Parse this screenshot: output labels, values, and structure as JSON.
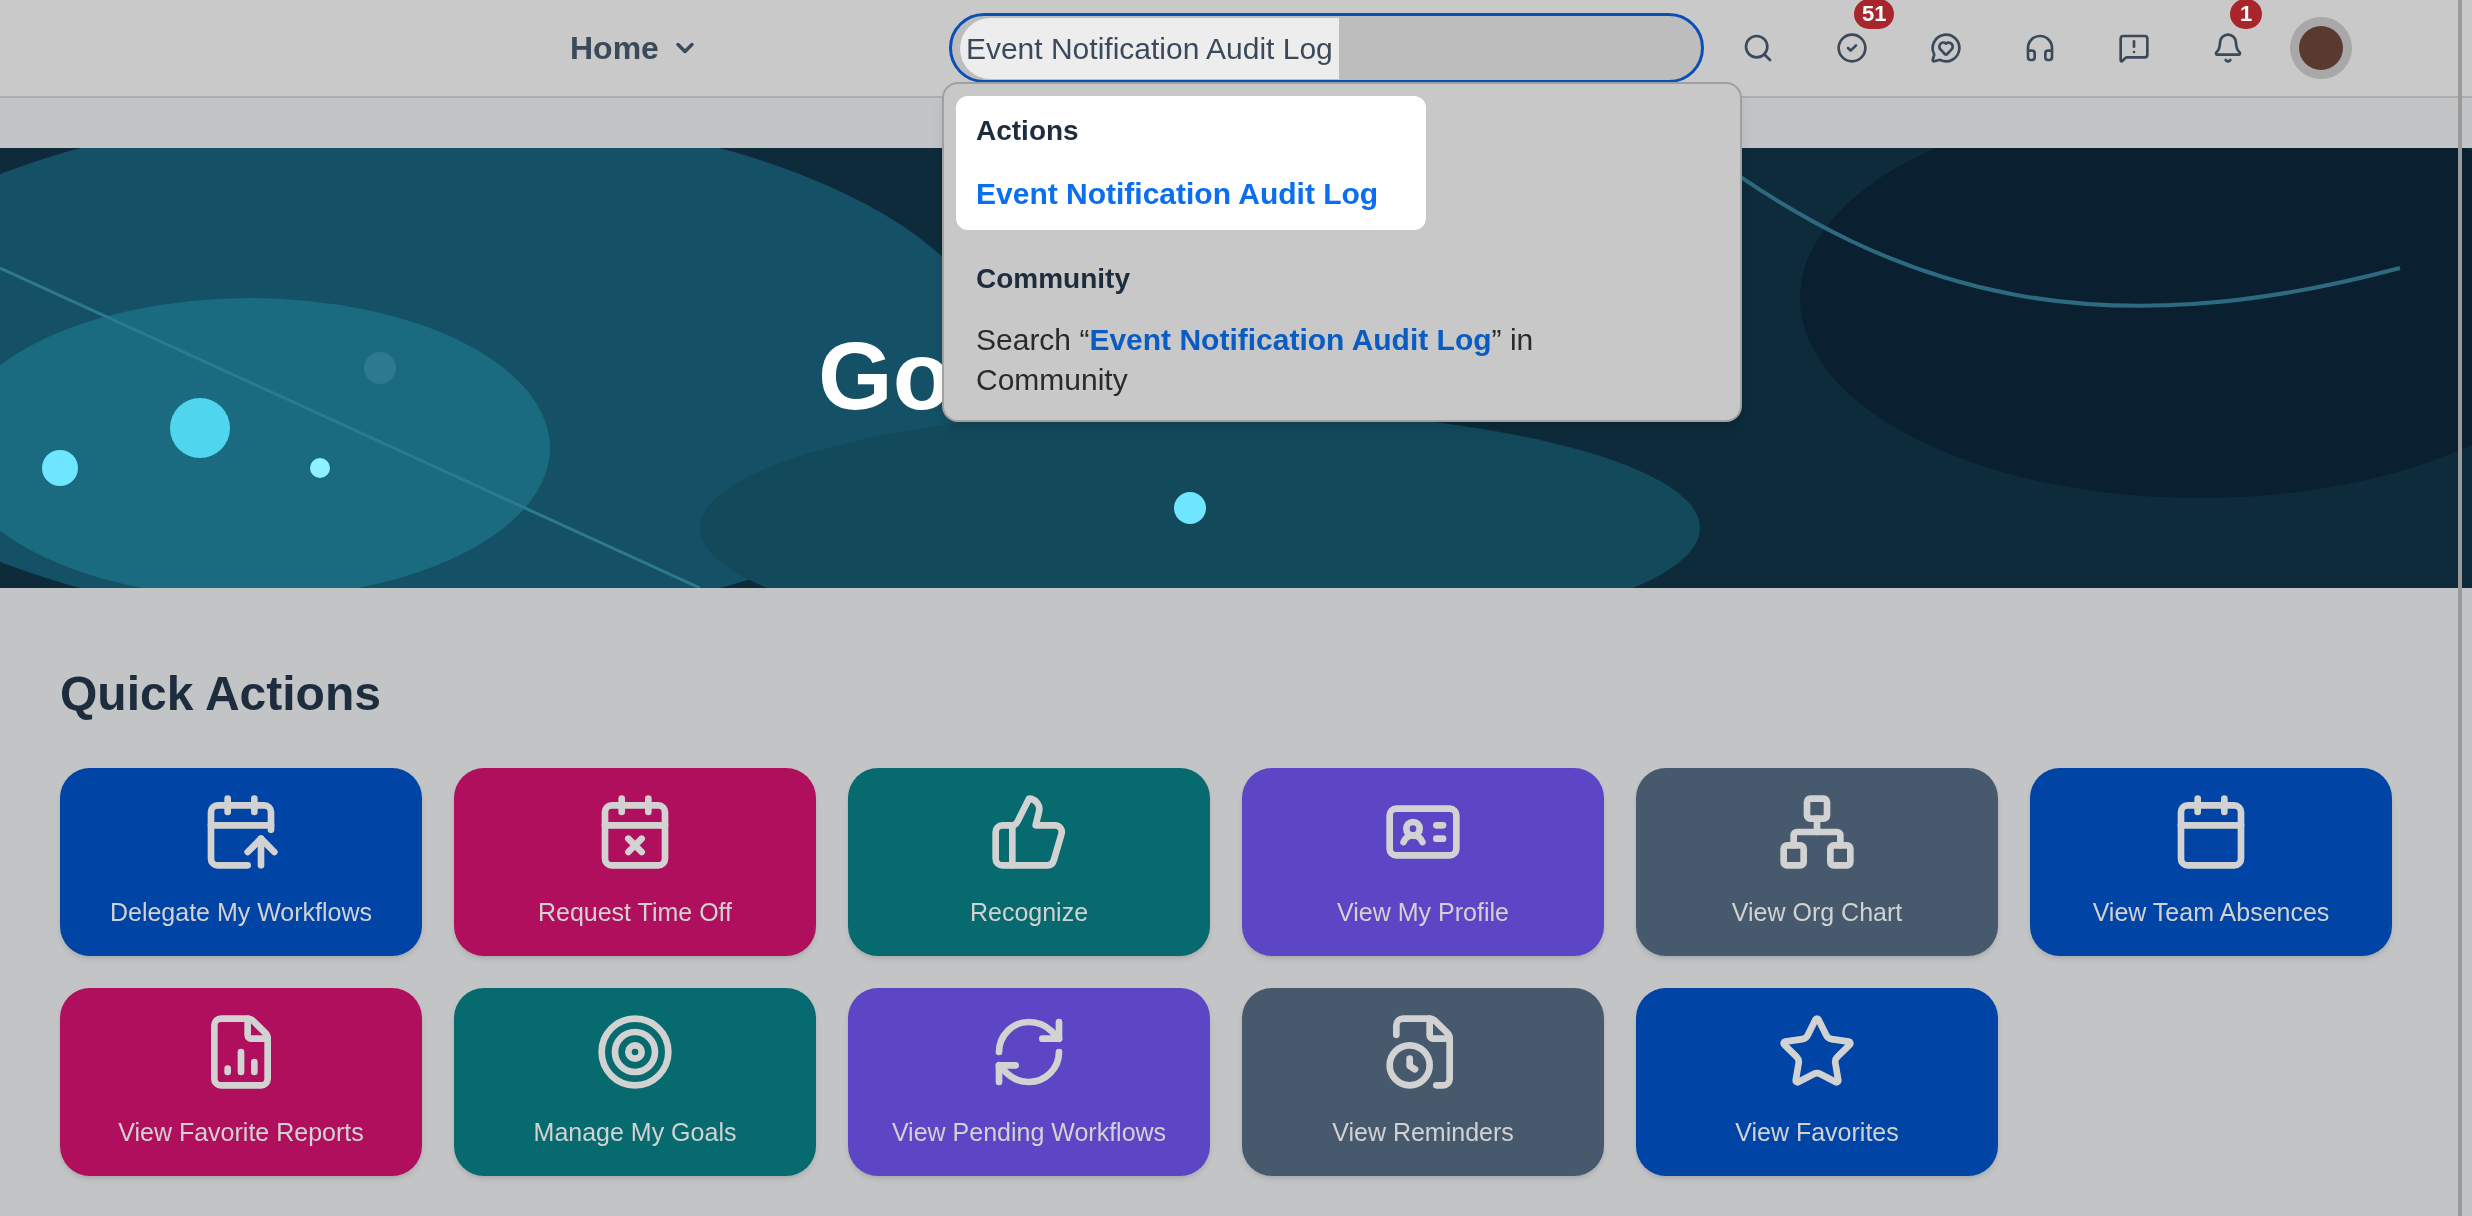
{
  "header": {
    "nav_menu": {
      "label": "Home"
    },
    "search": {
      "value": "Event Notification Audit Log"
    },
    "actions": [
      {
        "kind": "search"
      },
      {
        "kind": "todo",
        "badge": "51"
      },
      {
        "kind": "chat"
      },
      {
        "kind": "support"
      },
      {
        "kind": "feedback"
      },
      {
        "kind": "notifications",
        "badge": "1"
      },
      {
        "kind": "avatar"
      }
    ]
  },
  "search_dropdown": {
    "sections": [
      {
        "title": "Actions",
        "items": [
          {
            "text": "Event Notification Audit Log",
            "selected": true
          }
        ]
      },
      {
        "title": "Community",
        "items": [
          {
            "text": "Search “**Event Notification Audit Log**” in Community",
            "selected": false
          }
        ]
      }
    ]
  },
  "hero": {
    "title": "Go"
  },
  "quick_actions": {
    "title": "Quick Actions",
    "tiles": [
      {
        "label": "Delegate My Workflows",
        "color": "#0044a5"
      },
      {
        "label": "Request Time Off",
        "color": "#b00f5e"
      },
      {
        "label": "Recognize",
        "color": "#066a6e"
      },
      {
        "label": "View My Profile",
        "color": "#5d46c6"
      },
      {
        "label": "View Org Chart",
        "color": "#475a6d"
      },
      {
        "label": "View Team Absences",
        "color": "#0044a5"
      },
      {
        "label": "View Favorite Reports",
        "color": "#b00f5e"
      },
      {
        "label": "Manage My Goals",
        "color": "#066a6e"
      },
      {
        "label": "View Pending Workflows",
        "color": "#5d46c6"
      },
      {
        "label": "View Reminders",
        "color": "#475a6d"
      },
      {
        "label": "View Favorites",
        "color": "#0044a5"
      }
    ]
  }
}
